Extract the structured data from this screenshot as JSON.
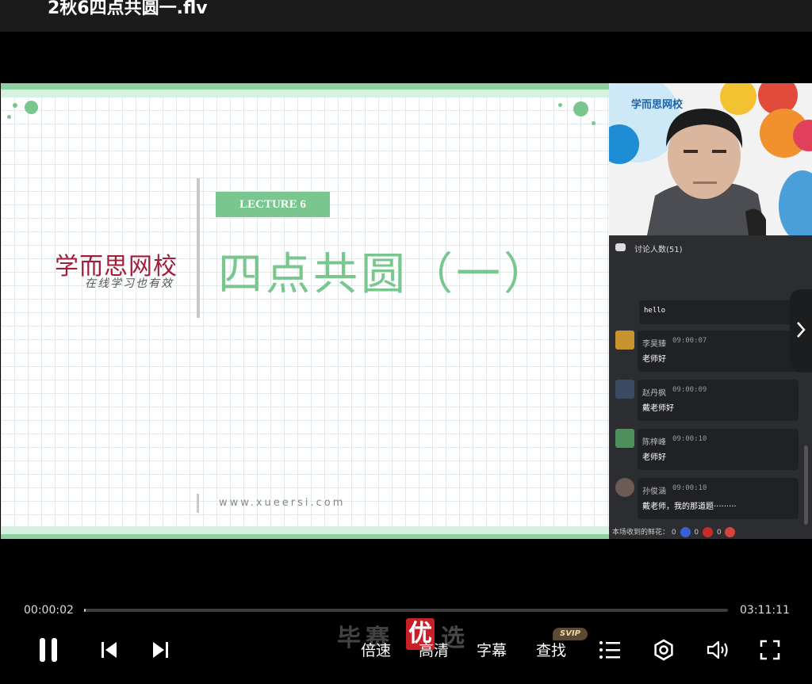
{
  "window": {
    "title": "2秋6四点共圆一.flv"
  },
  "slide": {
    "brand_name": "学而思网校",
    "brand_slogan": "在线学习也有效",
    "lecture_tag": "LECTURE 6",
    "title": "四点共圆（一）",
    "url": "www.xueersi.com"
  },
  "webcam": {
    "logo": "学而思网校"
  },
  "chat": {
    "header": "讨论人数(51)",
    "first_message": "hello",
    "messages": [
      {
        "name": "李昊臻",
        "time": "09:00:07",
        "text": "老师好",
        "avatar_color": "#c8932f"
      },
      {
        "name": "赵丹枫",
        "time": "09:00:09",
        "text": "戴老师好",
        "avatar_color": "#3b4a63"
      },
      {
        "name": "陈梓峰",
        "time": "09:00:10",
        "text": "老师好",
        "avatar_color": "#4e8f5b"
      },
      {
        "name": "孙俊涵",
        "time": "09:00:10",
        "text": "戴老师，我的那道题·········",
        "avatar_color": "#6b5a55"
      }
    ],
    "flowers_label": "本场收到的鲜花：",
    "flower_counts": [
      "0",
      "0",
      "0"
    ]
  },
  "player": {
    "current_time": "00:00:02",
    "total_time": "03:11:11",
    "progress": 0.0002,
    "buttons": {
      "speed": "倍速",
      "quality": "高清",
      "subtitle": "字幕",
      "search": "查找",
      "svip_badge": "SVIP"
    }
  },
  "watermark": {
    "text_left": "毕赛",
    "text_mid": "优",
    "text_right": "选"
  },
  "colors": {
    "accent_green": "#79c78f",
    "brand_red": "#a01e3a",
    "svip_gold": "#f1d7a6"
  }
}
